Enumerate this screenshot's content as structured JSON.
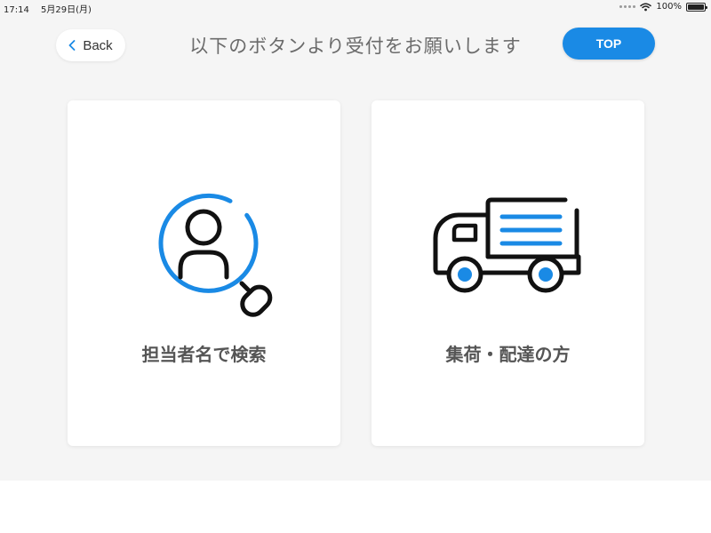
{
  "status_bar": {
    "time": "17:14",
    "date": "5月29日(月)",
    "battery": "100%",
    "battery_level": 1.0
  },
  "header": {
    "back_label": "Back",
    "title": "以下のボタンより受付をお願いします",
    "top_label": "TOP"
  },
  "cards": [
    {
      "label": "担当者名で検索",
      "icon": "person-search-icon"
    },
    {
      "label": "集荷・配達の方",
      "icon": "delivery-truck-icon"
    }
  ],
  "colors": {
    "accent": "#1a8ae5",
    "background": "#f5f5f5",
    "card": "#ffffff",
    "text": "#555555",
    "icon_stroke": "#111111"
  }
}
